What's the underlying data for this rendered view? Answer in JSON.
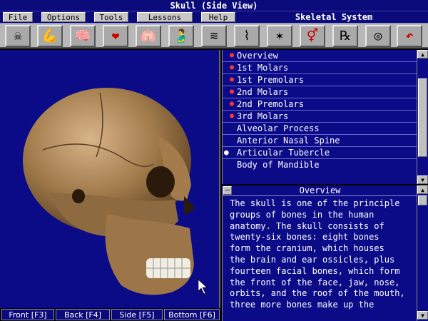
{
  "window": {
    "title": "Skull (Side View)"
  },
  "menu": {
    "items": [
      "File",
      "Options",
      "Tools",
      "Lessons",
      "Help"
    ],
    "section_title": "Skeletal System"
  },
  "toolbar": {
    "icons": [
      "skull-icon",
      "muscle-icon",
      "brain-icon",
      "heart-icon",
      "lungs-icon",
      "stomach-icon",
      "nerves-icon",
      "pancreas-icon",
      "cell-icon",
      "gender-icon",
      "rx-icon",
      "ear-icon",
      "return-icon"
    ],
    "glyphs": [
      "☠",
      "💪",
      "🧠",
      "❤",
      "🫁",
      "🫃",
      "≋",
      "⌇",
      "✶",
      "⚥",
      "℞",
      "◎",
      "↶"
    ]
  },
  "colors": {
    "panel_bg": "#0b0b88",
    "title_bg": "#0a0a7a",
    "marker": "#ff3333",
    "skull": "#b08a5a"
  },
  "list": {
    "items": [
      {
        "label": "Overview",
        "marker": "red"
      },
      {
        "label": "1st Molars",
        "marker": "red"
      },
      {
        "label": "1st Premolars",
        "marker": "red"
      },
      {
        "label": "2nd Molars",
        "marker": "red"
      },
      {
        "label": "2nd Premolars",
        "marker": "red"
      },
      {
        "label": "3rd Molars",
        "marker": "red"
      },
      {
        "label": "Alveolar Process",
        "marker": ""
      },
      {
        "label": "Anterior Nasal Spine",
        "marker": ""
      },
      {
        "label": "Articular Tubercle",
        "marker": "current"
      },
      {
        "label": "Body of Mandible",
        "marker": ""
      }
    ]
  },
  "textpanel": {
    "heading": "Overview",
    "lines": [
      "The skull is one of the principle",
      "groups of bones in the human",
      "anatomy. The skull consists of",
      "twenty-six bones: eight bones",
      "form the cranium, which houses",
      "the brain and ear ossicles, plus",
      "fourteen facial bones, which form",
      "the front of the face, jaw, nose,",
      "orbits, and the roof of the mouth,",
      "three more bones make up the"
    ]
  },
  "views": [
    "Front [F3]",
    "Back [F4]",
    "Side [F5]",
    "Bottom [F6]"
  ]
}
